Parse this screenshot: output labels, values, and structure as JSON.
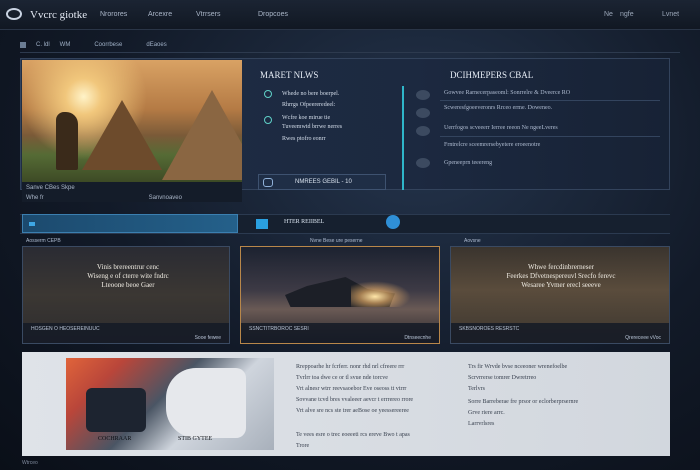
{
  "brand": "Vvcrc giotke",
  "nav": [
    "Nrorores",
    "Arcexre",
    "Vtrrsers",
    "Dropcoes"
  ],
  "top_right": [
    "Ne",
    "ngfe",
    "Lvnet"
  ],
  "subbar": [
    "C. ldl",
    "WM",
    "Coorrbese",
    "dEaoes"
  ],
  "news": {
    "title": "MARET NLWS",
    "items": [
      "Whede no bere boerpel.",
      "Rhrrgs Ofpeereredeel:",
      "Wcfre koe mirue tie\nTuveemwtd brrwe nerres",
      "Rwes ptofro eonrr"
    ],
    "button": "NMREES GEBIL - 10"
  },
  "developers": {
    "title": "DCIHMEPERS CBAL",
    "rows": [
      "Gowvee Rarnecerpaseoml: Sonrrelre & Dveerce RO",
      "Scweresfgoeeveronrs Rrceo erme. Doweneo.",
      "Uerrfogos scveeerr Ierree reeon Ne ngeeLveres",
      "Frntrelcre sceemrersebyetere eroeenotre",
      "Gpeneeprn teeereng"
    ]
  },
  "hero_caption": {
    "line1": "Sanve CBes Skpe",
    "line2": "Whe fr",
    "line3": "Sanvnoaveo"
  },
  "tabs": {
    "active_label": "",
    "mid_label": "HTER REIIBEL",
    "left_cat": "Aosserm CEPB",
    "mid_cat": "Nvne Bese ure peserne",
    "right_cat": "Aovsne"
  },
  "cards": [
    {
      "lines": [
        "Vinis brereentrur cenc",
        "Wiseng e of cterre wite fndrc",
        "Lteoone beoe Gaer"
      ],
      "foot_a": "HOSGEN O HEOSEREINUUC",
      "foot_b": "Sooe fewee"
    },
    {
      "lines": [],
      "foot_a": "SSNCTITRBOROC SESRI",
      "foot_b": "Dtnseecnhe"
    },
    {
      "lines": [
        "Whwe fercdinbrerneser",
        "Feerkes Dfvetnespereuvl Srecfo ferevc",
        "Wesaree Yvmer erecl seeeve"
      ],
      "foot_a": "SKBSNOROES RESRSTC",
      "foot_b": "Qrereceee vVoc"
    }
  ],
  "bottom": {
    "img_cap1": "COCHRAAR",
    "img_cap2": "STIB GYTEE",
    "col1": [
      "Rreppoarhe hr fcrferr. nonr rhd nrl cfreere rrr",
      "Tvrlrr toa dwe ce or tl svue nde torcve",
      "Vrt alnesr wtrr reevsaoebor Eve oseoss tt vtrrr",
      "Sovvane tcvd bres vvaleeer aevcr t errrereo rrore",
      "Vrt alve sre ncs ste trer aeBose oe yeessereeree",
      "",
      "Te vees esre o trec eoeeeti rcs ereve Bwo t apas",
      "Trore"
    ],
    "col2": [
      "Trs fir Wrvde bvse nceeoner wrenefoelbe",
      "Scrvrrerse tomrer Dwretrreo",
      "Terlvrs",
      "Sorre Barreberae fre prsor or eclorberprsernre",
      "Grve riere arrc.",
      "Larrvrlsres"
    ]
  },
  "corner_label": "Wtrceo"
}
